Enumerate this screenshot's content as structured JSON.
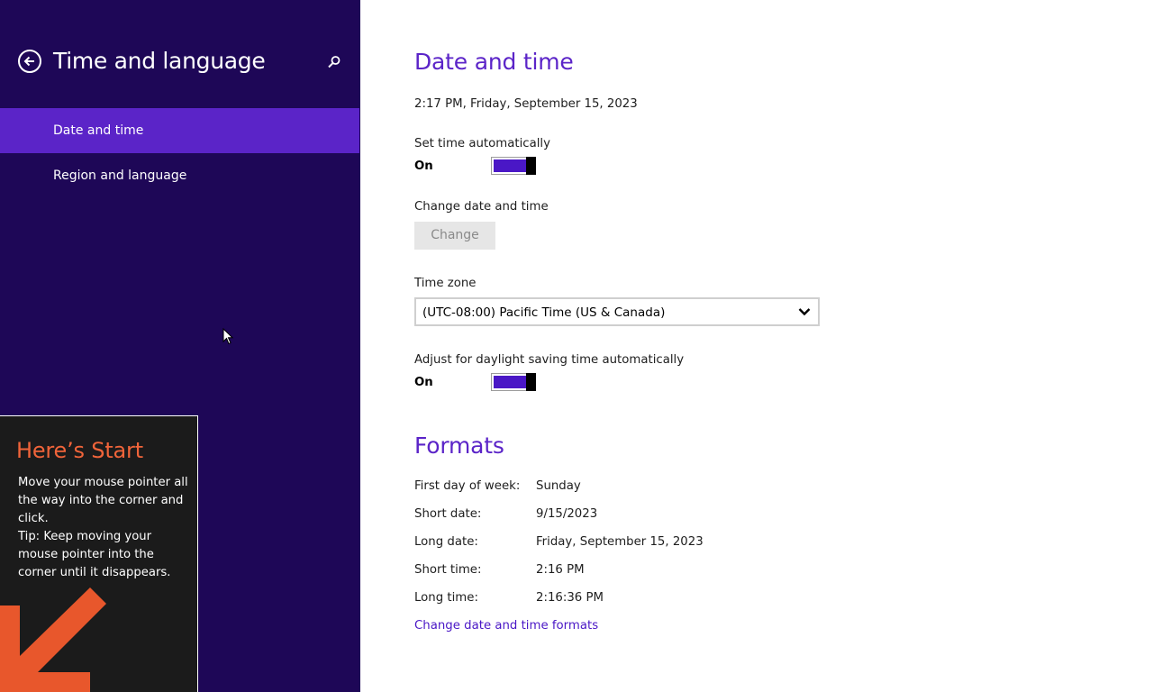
{
  "sidebar": {
    "title": "Time and language",
    "items": [
      {
        "label": "Date and time",
        "active": true
      },
      {
        "label": "Region and language",
        "active": false
      }
    ]
  },
  "tip": {
    "title": "Here’s Start",
    "body": "Move your mouse pointer all the way into the corner and click.",
    "tip_text": "Tip: Keep moving your mouse pointer into the corner until it disappears."
  },
  "date_time": {
    "section_title": "Date and time",
    "current": "2:17 PM, Friday, September 15, 2023",
    "set_auto": {
      "label": "Set time automatically",
      "state": "On"
    },
    "change": {
      "label": "Change date and time",
      "button": "Change"
    },
    "time_zone": {
      "label": "Time zone",
      "value": "(UTC-08:00) Pacific Time (US & Canada)"
    },
    "dst": {
      "label": "Adjust for daylight saving time automatically",
      "state": "On"
    }
  },
  "formats": {
    "section_title": "Formats",
    "rows": [
      {
        "label": "First day of week:",
        "value": "Sunday"
      },
      {
        "label": "Short date:",
        "value": "9/15/2023"
      },
      {
        "label": "Long date:",
        "value": "Friday, September 15, 2023"
      },
      {
        "label": "Short time:",
        "value": "2:16 PM"
      },
      {
        "label": "Long time:",
        "value": "2:16:36 PM"
      }
    ],
    "link": "Change date and time formats"
  },
  "colors": {
    "sidebar_bg": "#1e0757",
    "accent": "#5b24c8",
    "toggle_fill": "#4a17c6",
    "tip_title": "#f0643a"
  }
}
